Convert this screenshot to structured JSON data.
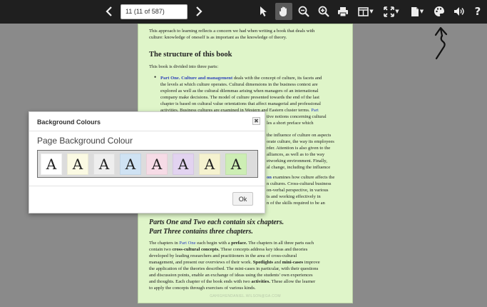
{
  "toolbar": {
    "page_field_value": "11 (11 of 587)",
    "icons": [
      "chevron-left-icon",
      "chevron-right-icon",
      "pointer-icon",
      "hand-icon",
      "zoom-out-icon",
      "zoom-in-icon",
      "print-icon",
      "view-mode-icon",
      "fit-icon",
      "document-icon",
      "palette-icon",
      "volume-icon",
      "help-icon"
    ],
    "help_label": "?"
  },
  "document": {
    "intro_line1": "This approach to learning reflects a concern we had when writing a book that deals with",
    "intro_line2": "culture: knowledge of oneself is as important as the knowledge of theory.",
    "section_heading": "The structure of this book",
    "divided_text": "This book is divided into three parts:",
    "part_one_link": "Part One. Culture and management",
    "part_one_rest": " deals with the concept of culture, its facets and",
    "p1_line2": "the levels at which culture operates. Cultural dimensions in the business context are",
    "p1_line3": "explored as well as the cultural dilemmas arising when managers of an international",
    "p1_line4": "company make decisions. The model of culture presented towards the end of the last",
    "p1_line5": "chapter is based on cultural value orientations that affect managerial and professional",
    "p1_line6a": "activities. Business cultures are examined in Western and Eastern cluster terms.",
    "p1_line6b": "Part",
    "frag1": "tive notions concerning cultural",
    "frag2": "les a short preface which",
    "frag3": "the influence of culture on aspects",
    "frag4": "orate culture, the way its employees",
    "frag5": "rder. Attention is also given to the",
    "frag6": "alliances, as well as to the way",
    "frag7": "etworking environment. Finally,",
    "frag8": "al change, including the influence",
    "frag9a": "on",
    "frag9b": " examines how culture affects the",
    "frag10": "n cultures. Cross-cultural business",
    "frag11": "on-verbal perspective, in various",
    "frag12": "ts and working effectively in",
    "frag13": "n of the skills required to be an",
    "italic_heading1": "Parts One and Two each contain six chapters.",
    "italic_heading2": "Part Three contains three chapters.",
    "c_line1a": "The chapters in ",
    "c_line1_link": "Part One",
    "c_line1b": " each begin with a ",
    "c_line1_bold": "preface.",
    "c_line1c": " The chapters in all three parts each",
    "c_line2a": "contain two ",
    "c_line2_bold": "cross-cultural concepts.",
    "c_line2b": " These concepts address key ideas and theories",
    "c_line3": "developed by leading researchers and practitioners in the area of cross-cultural",
    "c_line4a": "management, and present our overviews of their work. ",
    "c_line4_bold1": "Spotlights",
    "c_line4b": " and ",
    "c_line4_bold2": "mini-cases",
    "c_line4c": " improve",
    "c_line5": "the application of the theories described. The mini-cases in particular, with their questions",
    "c_line6": "and discussion points, enable an exchange of ideas using the students' own experiences",
    "c_line7a": "and thoughts. Each chapter of the book ends with two ",
    "c_line7_bold": "activities.",
    "c_line7b": " These allow the learner",
    "c_line8": "to apply the concepts through exercises of various kinds.",
    "footer": "GAHIGHENDANIEL.WILSON@GA.COM"
  },
  "dialog": {
    "title": "Background Colours",
    "close_label": "✖",
    "label": "Page Background Colour",
    "swatch_letter": "A",
    "swatches": [
      "#ffffff",
      "#fbfae3",
      "#eeeeee",
      "#cfe2f3",
      "#f6dbe6",
      "#e2d3f0",
      "#f5f2cf",
      "#cdeeb4"
    ],
    "ok_label": "Ok"
  },
  "colors": {
    "toolbar_bg": "#1f1f1f",
    "viewer_bg": "#8a8a8a",
    "page_bg": "#dff5c9",
    "link": "#2a3fb8"
  }
}
